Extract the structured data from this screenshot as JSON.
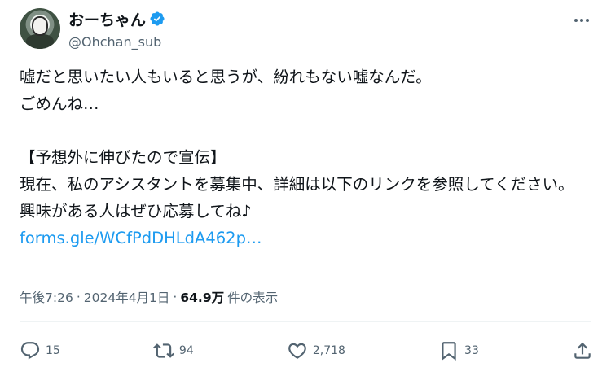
{
  "author": {
    "display_name": "おーちゃん",
    "handle": "@Ohchan_sub",
    "verified": true
  },
  "tweet": {
    "text": "嘘だと思いたい人もいると思うが、紛れもない嘘なんだ。\nごめんね…\n\n【予想外に伸びたので宣伝】\n現在、私のアシスタントを募集中、詳細は以下のリンクを参照してください。\n興味がある人はぜひ応募してね♪",
    "link": "forms.gle/WCfPdDHLdA462p…"
  },
  "meta": {
    "time": "午後7:26",
    "sep1": "·",
    "date": "2024年4月1日",
    "sep2": "·",
    "views_count": "64.9万",
    "views_label": "件の表示"
  },
  "actions": {
    "replies": "15",
    "reposts": "94",
    "likes": "2,718",
    "bookmarks": "33"
  },
  "colors": {
    "link": "#1d9bf0",
    "verified": "#1d9bf0",
    "muted": "#536471"
  }
}
